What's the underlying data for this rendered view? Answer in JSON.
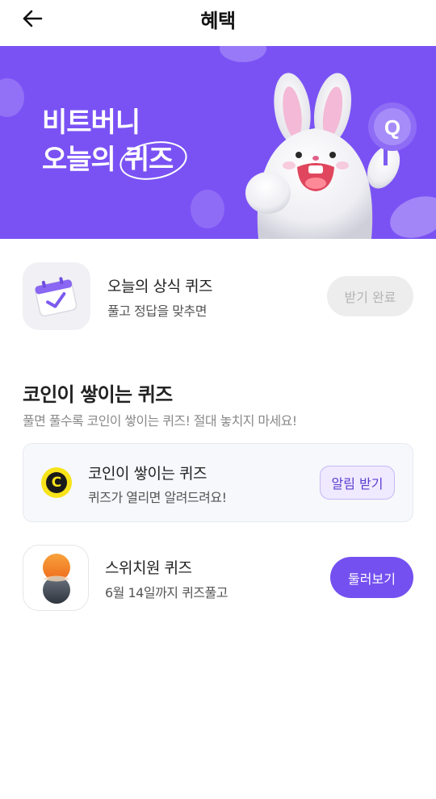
{
  "header": {
    "title": "혜택",
    "back_icon": "arrow-left-icon"
  },
  "banner": {
    "line1": "비트버니",
    "line2_prefix": "오늘의",
    "line2_highlight": "퀴즈",
    "background_color": "#7a52f4"
  },
  "daily_quiz": {
    "icon": "calendar-check-icon",
    "title": "오늘의 상식 퀴즈",
    "subtitle": "풀고 정답을 맞추면",
    "button_label": "받기 완료"
  },
  "coin_section": {
    "title": "코인이 쌓이는 퀴즈",
    "subtitle": "풀면 풀수록 코인이 쌓이는 퀴즈! 절대 놓치지 마세요!",
    "card": {
      "icon": "coin-c-icon",
      "icon_letter": "C",
      "title": "코인이 쌓이는 퀴즈",
      "subtitle": "퀴즈가 열리면 알려드려요!",
      "button_label": "알림 받기"
    }
  },
  "switch_quiz": {
    "icon": "switch-one-logo-icon",
    "title": "스위치원 퀴즈",
    "subtitle": "6월 14일까지 퀴즈풀고",
    "button_label": "둘러보기",
    "accent_color": "#7450f0"
  }
}
